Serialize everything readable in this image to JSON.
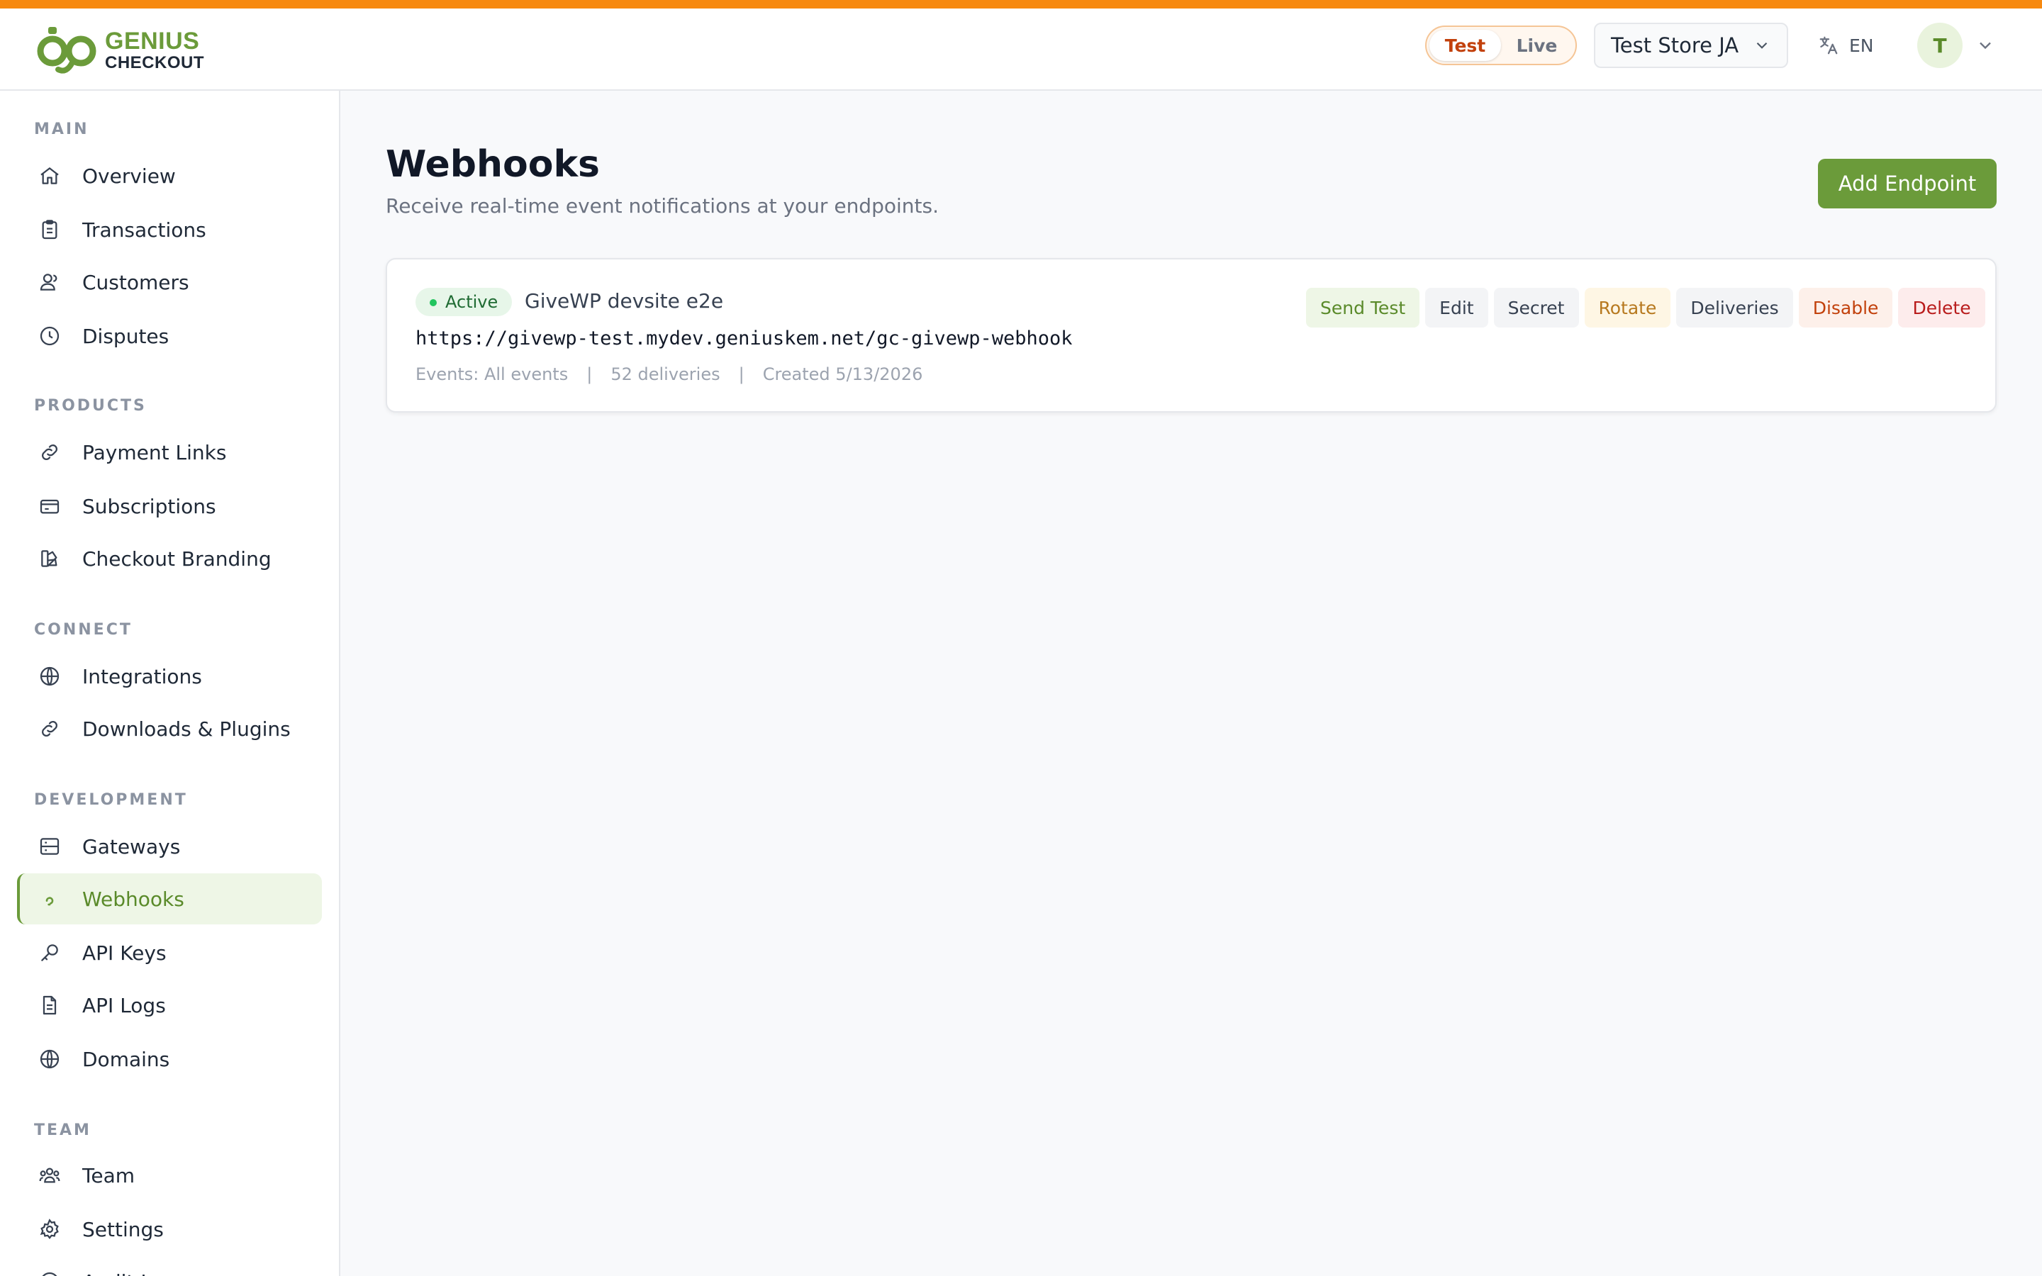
{
  "brand": {
    "name_top": "GENIUS",
    "name_bottom": "CHECKOUT",
    "accent": "#6b9b3a",
    "top_stripe": "#f7890f"
  },
  "header": {
    "mode_toggle": {
      "options": [
        "Test",
        "Live"
      ],
      "selected": "Test"
    },
    "store_select": {
      "value": "Test Store JA",
      "icon": "chevron-down-icon"
    },
    "language": {
      "icon": "translate-icon",
      "label": "EN"
    },
    "user": {
      "avatar_initial": "T",
      "icon": "chevron-down-icon"
    }
  },
  "sidebar": {
    "sections": [
      {
        "title": "MAIN",
        "items": [
          {
            "label": "Overview",
            "icon": "home-icon"
          },
          {
            "label": "Transactions",
            "icon": "clipboard-icon"
          },
          {
            "label": "Customers",
            "icon": "users-icon"
          },
          {
            "label": "Disputes",
            "icon": "clock-icon"
          }
        ]
      },
      {
        "title": "PRODUCTS",
        "items": [
          {
            "label": "Payment Links",
            "icon": "link-icon"
          },
          {
            "label": "Subscriptions",
            "icon": "card-icon"
          },
          {
            "label": "Checkout Branding",
            "icon": "palette-icon"
          }
        ]
      },
      {
        "title": "CONNECT",
        "items": [
          {
            "label": "Integrations",
            "icon": "globe-icon"
          },
          {
            "label": "Downloads & Plugins",
            "icon": "link-icon"
          }
        ]
      },
      {
        "title": "DEVELOPMENT",
        "items": [
          {
            "label": "Gateways",
            "icon": "server-icon"
          },
          {
            "label": "Webhooks",
            "icon": "webhook-icon",
            "active": true
          },
          {
            "label": "API Keys",
            "icon": "key-icon"
          },
          {
            "label": "API Logs",
            "icon": "document-icon"
          },
          {
            "label": "Domains",
            "icon": "globe-icon"
          }
        ]
      },
      {
        "title": "TEAM",
        "items": [
          {
            "label": "Team",
            "icon": "team-icon"
          },
          {
            "label": "Settings",
            "icon": "gear-icon"
          },
          {
            "label": "Audit Log",
            "icon": "audit-icon"
          }
        ]
      }
    ]
  },
  "main": {
    "title": "Webhooks",
    "subtitle": "Receive real-time event notifications at your endpoints.",
    "add_button": "Add Endpoint",
    "endpoints": [
      {
        "status": "Active",
        "name": "GiveWP devsite e2e",
        "url": "https://givewp-test.mydev.geniuskem.net/gc-givewp-webhook",
        "events": "Events: All events",
        "deliveries": "52 deliveries",
        "created": "Created 5/13/2026",
        "actions": [
          "Send Test",
          "Edit",
          "Secret",
          "Rotate",
          "Deliveries",
          "Disable",
          "Delete"
        ]
      }
    ]
  }
}
